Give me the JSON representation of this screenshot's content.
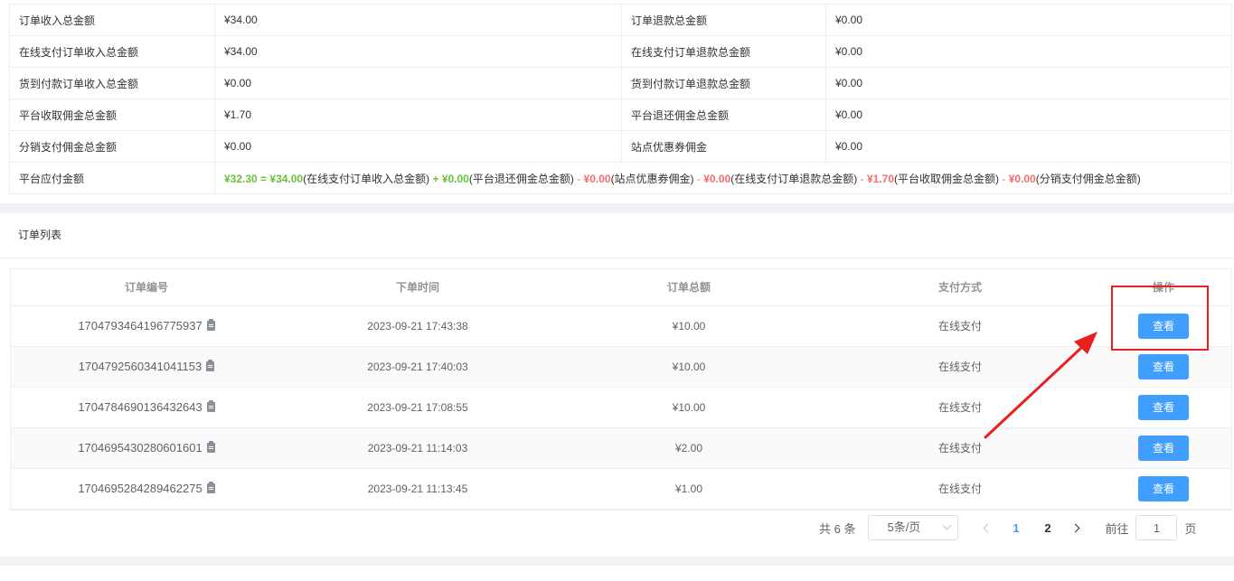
{
  "summary": {
    "rows": [
      {
        "k1": "订单收入总金额",
        "v1": "¥34.00",
        "k2": "订单退款总金额",
        "v2": "¥0.00"
      },
      {
        "k1": "在线支付订单收入总金额",
        "v1": "¥34.00",
        "k2": "在线支付订单退款总金额",
        "v2": "¥0.00"
      },
      {
        "k1": "货到付款订单收入总金额",
        "v1": "¥0.00",
        "k2": "货到付款订单退款总金额",
        "v2": "¥0.00"
      },
      {
        "k1": "平台收取佣金总金额",
        "v1": "¥1.70",
        "k2": "平台退还佣金总金额",
        "v2": "¥0.00"
      },
      {
        "k1": "分销支付佣金总金额",
        "v1": "¥0.00",
        "k2": "站点优惠券佣金",
        "v2": "¥0.00"
      }
    ],
    "payable_label": "平台应付金额",
    "formula": {
      "result": "¥32.30",
      "eq": "=",
      "t1_val": "¥34.00",
      "t1_label": "(在线支付订单收入总金额)",
      "plus": "+",
      "t2_val": "¥0.00",
      "t2_label": "(平台退还佣金总金额)",
      "m1": "-",
      "t3_val": "¥0.00",
      "t3_label": "(站点优惠券佣金)",
      "m2": "-",
      "t4_val": "¥0.00",
      "t4_label": "(在线支付订单退款总金额)",
      "m3": "-",
      "t5_val": "¥1.70",
      "t5_label": "(平台收取佣金总金额)",
      "m4": "-",
      "t6_val": "¥0.00",
      "t6_label": "(分销支付佣金总金额)"
    }
  },
  "orders": {
    "section_title": "订单列表",
    "columns": [
      "订单编号",
      "下单时间",
      "订单总额",
      "支付方式",
      "操作"
    ],
    "rows": [
      {
        "no": "1704793464196775937",
        "time": "2023-09-21 17:43:38",
        "amount": "¥10.00",
        "pay": "在线支付",
        "action": "查看"
      },
      {
        "no": "1704792560341041153",
        "time": "2023-09-21 17:40:03",
        "amount": "¥10.00",
        "pay": "在线支付",
        "action": "查看"
      },
      {
        "no": "1704784690136432643",
        "time": "2023-09-21 17:08:55",
        "amount": "¥10.00",
        "pay": "在线支付",
        "action": "查看"
      },
      {
        "no": "1704695430280601601",
        "time": "2023-09-21 11:14:03",
        "amount": "¥2.00",
        "pay": "在线支付",
        "action": "查看"
      },
      {
        "no": "1704695284289462275",
        "time": "2023-09-21 11:13:45",
        "amount": "¥1.00",
        "pay": "在线支付",
        "action": "查看"
      }
    ]
  },
  "pagination": {
    "total": "共 6 条",
    "page_size": "5条/页",
    "pages": [
      "1",
      "2"
    ],
    "jump_label": "前往",
    "jump_value": "1",
    "page_unit": "页"
  }
}
